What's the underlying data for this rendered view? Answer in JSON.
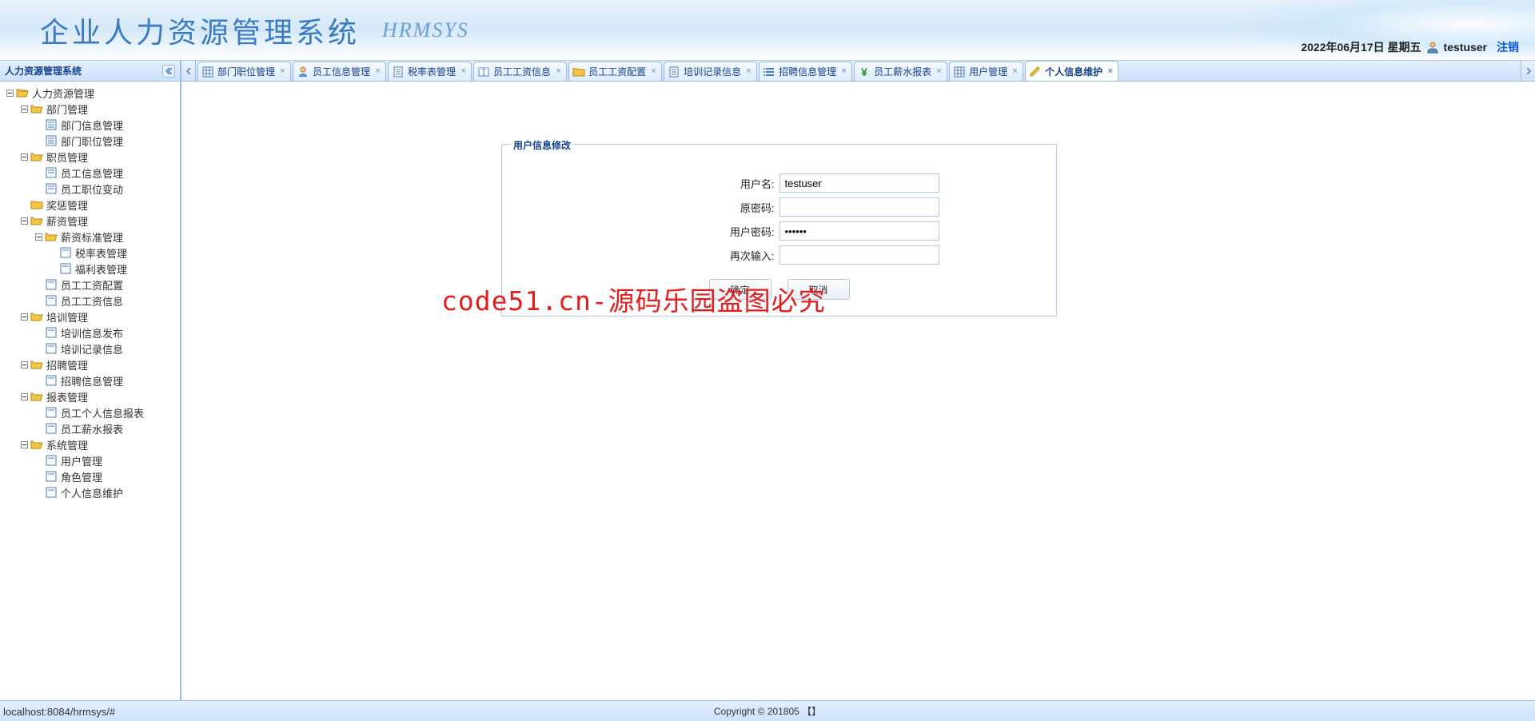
{
  "header": {
    "title": "企业人力资源管理系统",
    "subtitle": "HRMSYS",
    "date": "2022年06月17日 星期五",
    "username": "testuser",
    "logout": "注销"
  },
  "sidebar": {
    "title": "人力资源管理系统",
    "tree": {
      "root": "人力资源管理",
      "dept_mgmt": "部门管理",
      "dept_info": "部门信息管理",
      "dept_position": "部门职位管理",
      "staff_mgmt": "职员管理",
      "emp_info": "员工信息管理",
      "emp_pos_change": "员工职位变动",
      "reward_punish": "奖惩管理",
      "salary_mgmt": "薪资管理",
      "salary_std": "薪资标准管理",
      "tax_rate": "税率表管理",
      "welfare": "福利表管理",
      "salary_config": "员工工资配置",
      "salary_info": "员工工资信息",
      "training_mgmt": "培训管理",
      "training_publish": "培训信息发布",
      "training_record": "培训记录信息",
      "recruit_mgmt": "招聘管理",
      "recruit_info": "招聘信息管理",
      "report_mgmt": "报表管理",
      "emp_personal_report": "员工个人信息报表",
      "emp_salary_report": "员工薪水报表",
      "sys_mgmt": "系统管理",
      "user_mgmt": "用户管理",
      "role_mgmt": "角色管理",
      "personal_info": "个人信息维护"
    }
  },
  "tabs": [
    {
      "label": "部门职位管理",
      "icon": "grid"
    },
    {
      "label": "员工信息管理",
      "icon": "user"
    },
    {
      "label": "税率表管理",
      "icon": "doc"
    },
    {
      "label": "员工工资信息",
      "icon": "table"
    },
    {
      "label": "员工工资配置",
      "icon": "folder"
    },
    {
      "label": "培训记录信息",
      "icon": "doc"
    },
    {
      "label": "招聘信息管理",
      "icon": "list"
    },
    {
      "label": "员工薪水报表",
      "icon": "yen"
    },
    {
      "label": "用户管理",
      "icon": "grid"
    },
    {
      "label": "个人信息维护",
      "icon": "pencil",
      "active": true
    }
  ],
  "form": {
    "legend": "用户信息修改",
    "username_label": "用户名:",
    "username_value": "testuser",
    "old_pwd_label": "原密码:",
    "old_pwd_value": "",
    "new_pwd_label": "用户密码:",
    "new_pwd_value": "••••••",
    "confirm_label": "再次输入:",
    "confirm_value": "",
    "ok": "确定",
    "cancel": "取消"
  },
  "watermark": "code51.cn-源码乐园盗图必究",
  "footer": "Copyright © 201805  【】",
  "status_url": "localhost:8084/hrmsys/#"
}
